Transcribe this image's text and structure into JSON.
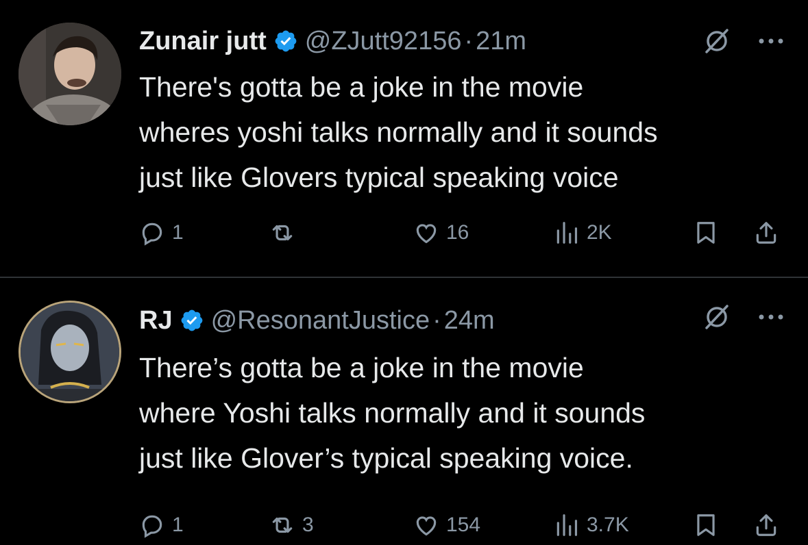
{
  "colors": {
    "background": "#000000",
    "text": "#e7e9ea",
    "secondary": "#8b98a5",
    "verified": "#1d9bf0",
    "divider": "#2f3336"
  },
  "tweets": [
    {
      "name": "Zunair jutt",
      "verified": true,
      "handle": "@ZJutt92156",
      "separator": "·",
      "time": "21m",
      "text": "There's gotta be a joke in the movie\nwheres yoshi talks normally and it sounds\njust like Glovers typical speaking voice",
      "replies": "1",
      "retweets": "",
      "likes": "16",
      "views": "2K",
      "icons": [
        "grok-icon",
        "more-icon",
        "reply-icon",
        "retweet-icon",
        "like-icon",
        "views-icon",
        "bookmark-icon",
        "share-icon"
      ]
    },
    {
      "name": "RJ",
      "verified": true,
      "handle": "@ResonantJustice",
      "separator": "·",
      "time": "24m",
      "text": "There’s gotta be a joke in the movie\nwhere Yoshi talks normally and it sounds\njust like Glover’s typical speaking voice.",
      "replies": "1",
      "retweets": "3",
      "likes": "154",
      "views": "3.7K",
      "icons": [
        "grok-icon",
        "more-icon",
        "reply-icon",
        "retweet-icon",
        "like-icon",
        "views-icon",
        "bookmark-icon",
        "share-icon"
      ]
    }
  ]
}
